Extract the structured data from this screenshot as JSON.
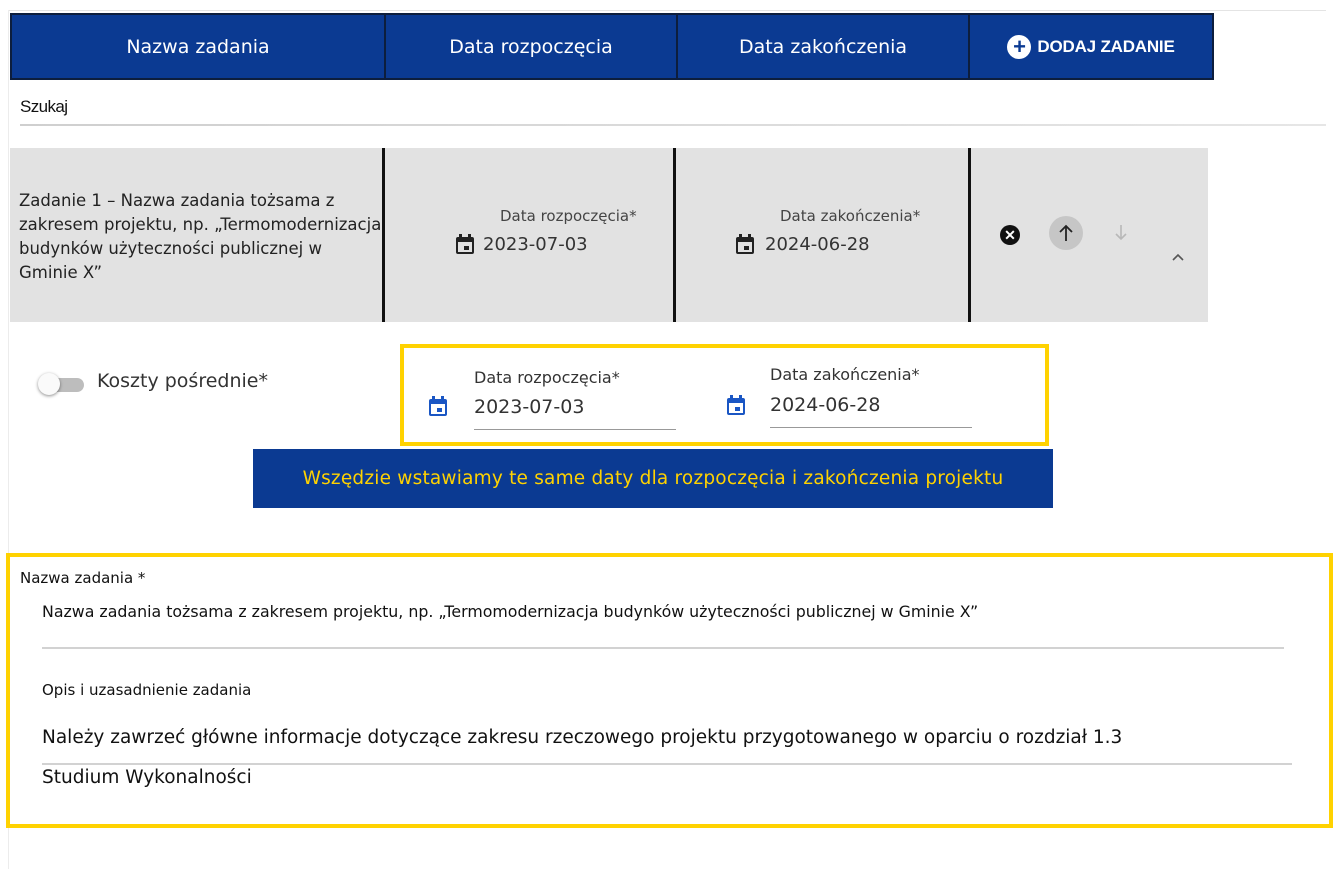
{
  "header": {
    "columns": {
      "name": "Nazwa zadania",
      "start": "Data rozpoczęcia",
      "end": "Data zakończenia"
    },
    "add_button_label": "DODAJ ZADANIE",
    "add_icon": "plus-circle-icon"
  },
  "search": {
    "label": "Szukaj"
  },
  "task": {
    "title": "Zadanie 1 – Nazwa zadania tożsama z zakresem projektu, np. „Termomodernizacja budynków użyteczności publicznej w Gminie X”",
    "start_label": "Data rozpoczęcia*",
    "start_value": "2023-07-03",
    "end_label": "Data zakończenia*",
    "end_value": "2024-06-28",
    "icons": [
      "remove-icon",
      "arrow-up-icon",
      "arrow-down-icon",
      "chevron-up-icon"
    ]
  },
  "indirect_costs": {
    "label": "Koszty pośrednie*",
    "enabled": false,
    "start_label": "Data rozpoczęcia*",
    "start_value": "2023-07-03",
    "end_label": "Data zakończenia*",
    "end_value": "2024-06-28"
  },
  "note": "Wszędzie wstawiamy te same daty dla rozpoczęcia i zakończenia projektu",
  "form": {
    "name_label": "Nazwa zadania *",
    "name_value": "Nazwa zadania tożsama z zakresem projektu, np. „Termomodernizacja budynków użyteczności publicznej w Gminie X”",
    "desc_label": "Opis i uzasadnienie zadania",
    "desc_line1": "Należy zawrzeć główne informacje dotyczące zakresu rzeczowego projektu przygotowanego w oparciu o rozdział 1.3",
    "desc_line2": "Studium Wykonalności"
  },
  "colors": {
    "header_bg": "#0b3a92",
    "highlight": "#ffd200",
    "calendar_blue": "#1a56c4",
    "row_bg": "#e2e2e2"
  }
}
